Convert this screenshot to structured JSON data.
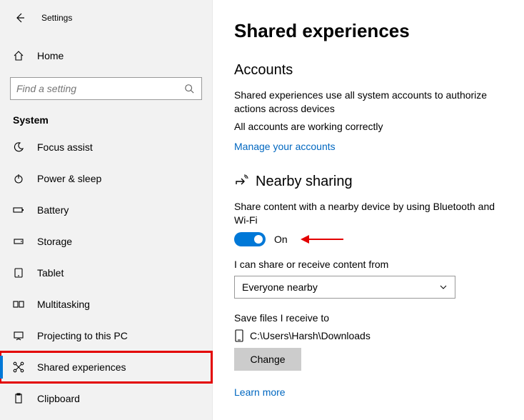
{
  "header": {
    "title": "Settings"
  },
  "home": {
    "label": "Home"
  },
  "search": {
    "placeholder": "Find a setting"
  },
  "category": "System",
  "nav": [
    {
      "label": "Focus assist"
    },
    {
      "label": "Power & sleep"
    },
    {
      "label": "Battery"
    },
    {
      "label": "Storage"
    },
    {
      "label": "Tablet"
    },
    {
      "label": "Multitasking"
    },
    {
      "label": "Projecting to this PC"
    },
    {
      "label": "Shared experiences"
    },
    {
      "label": "Clipboard"
    }
  ],
  "page": {
    "title": "Shared experiences",
    "accounts": {
      "heading": "Accounts",
      "desc": "Shared experiences use all system accounts to authorize actions across devices",
      "status": "All accounts are working correctly",
      "link": "Manage your accounts"
    },
    "nearby": {
      "heading": "Nearby sharing",
      "desc": "Share content with a nearby device by using Bluetooth and Wi-Fi",
      "toggle_state": "On",
      "source_label": "I can share or receive content from",
      "source_value": "Everyone nearby",
      "save_label": "Save files I receive to",
      "save_path": "C:\\Users\\Harsh\\Downloads",
      "change_btn": "Change",
      "learn_more": "Learn more"
    }
  }
}
